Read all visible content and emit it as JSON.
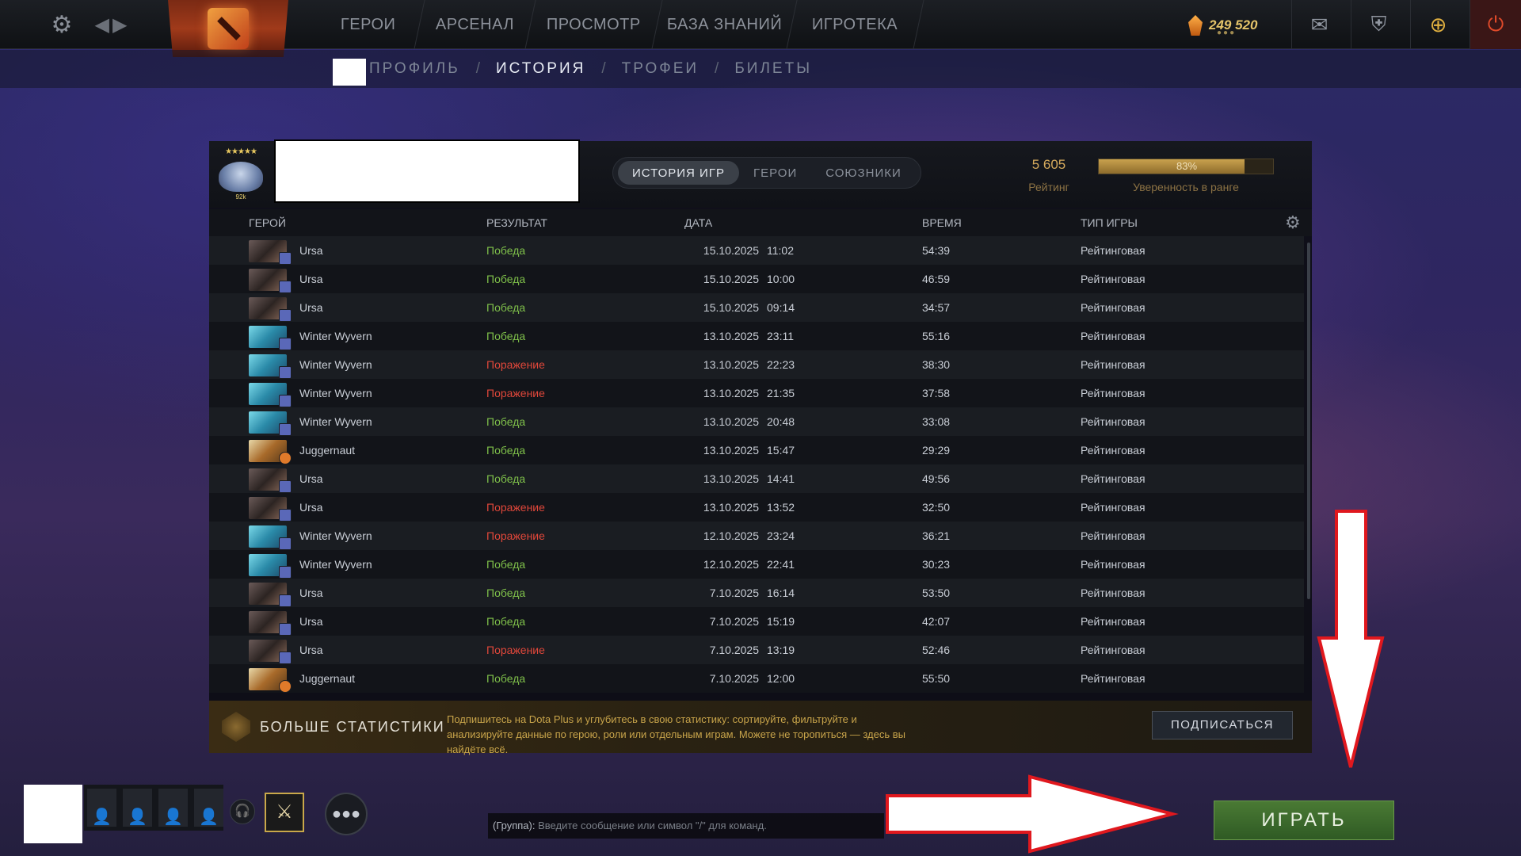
{
  "topbar": {
    "nav": [
      "ГЕРОИ",
      "АРСЕНАЛ",
      "ПРОСМОТР",
      "БАЗА ЗНАНИЙ",
      "ИГРОТЕКА"
    ],
    "currency_amount": "249 520",
    "icons": {
      "settings": "gear-icon",
      "back": "arrow-left-icon",
      "forward": "arrow-right-icon",
      "mail": "envelope-icon",
      "armory": "armory-icon",
      "dota_plus": "dota-plus-icon",
      "power": "power-icon"
    }
  },
  "subnav": {
    "items": [
      "ПРОФИЛЬ",
      "ИСТОРИЯ",
      "ТРОФЕИ",
      "БИЛЕТЫ"
    ],
    "active": "ИСТОРИЯ",
    "separator": "/"
  },
  "profile": {
    "rank_rank_number": "92k",
    "tabs": [
      "ИСТОРИЯ ИГР",
      "ГЕРОИ",
      "СОЮЗНИКИ"
    ],
    "active_tab": "ИСТОРИЯ ИГР",
    "rating_value": "5 605",
    "rating_label": "Рейтинг",
    "confidence_percent": 83,
    "confidence_text": "83%",
    "confidence_label": "Уверенность в ранге"
  },
  "table": {
    "headers": {
      "hero": "ГЕРОЙ",
      "result": "РЕЗУЛЬТАТ",
      "date": "ДАТА",
      "duration": "ВРЕМЯ",
      "mode": "ТИП ИГРЫ"
    },
    "rows": [
      {
        "hero": "Ursa",
        "result": "Победа",
        "win": true,
        "date": "15.10.2025",
        "time": "11:02",
        "duration": "54:39",
        "mode": "Рейтинговая"
      },
      {
        "hero": "Ursa",
        "result": "Победа",
        "win": true,
        "date": "15.10.2025",
        "time": "10:00",
        "duration": "46:59",
        "mode": "Рейтинговая"
      },
      {
        "hero": "Ursa",
        "result": "Победа",
        "win": true,
        "date": "15.10.2025",
        "time": "09:14",
        "duration": "34:57",
        "mode": "Рейтинговая"
      },
      {
        "hero": "Winter Wyvern",
        "result": "Победа",
        "win": true,
        "date": "13.10.2025",
        "time": "23:11",
        "duration": "55:16",
        "mode": "Рейтинговая"
      },
      {
        "hero": "Winter Wyvern",
        "result": "Поражение",
        "win": false,
        "date": "13.10.2025",
        "time": "22:23",
        "duration": "38:30",
        "mode": "Рейтинговая"
      },
      {
        "hero": "Winter Wyvern",
        "result": "Поражение",
        "win": false,
        "date": "13.10.2025",
        "time": "21:35",
        "duration": "37:58",
        "mode": "Рейтинговая"
      },
      {
        "hero": "Winter Wyvern",
        "result": "Победа",
        "win": true,
        "date": "13.10.2025",
        "time": "20:48",
        "duration": "33:08",
        "mode": "Рейтинговая"
      },
      {
        "hero": "Juggernaut",
        "result": "Победа",
        "win": true,
        "date": "13.10.2025",
        "time": "15:47",
        "duration": "29:29",
        "mode": "Рейтинговая"
      },
      {
        "hero": "Ursa",
        "result": "Победа",
        "win": true,
        "date": "13.10.2025",
        "time": "14:41",
        "duration": "49:56",
        "mode": "Рейтинговая"
      },
      {
        "hero": "Ursa",
        "result": "Поражение",
        "win": false,
        "date": "13.10.2025",
        "time": "13:52",
        "duration": "32:50",
        "mode": "Рейтинговая"
      },
      {
        "hero": "Winter Wyvern",
        "result": "Поражение",
        "win": false,
        "date": "12.10.2025",
        "time": "23:24",
        "duration": "36:21",
        "mode": "Рейтинговая"
      },
      {
        "hero": "Winter Wyvern",
        "result": "Победа",
        "win": true,
        "date": "12.10.2025",
        "time": "22:41",
        "duration": "30:23",
        "mode": "Рейтинговая"
      },
      {
        "hero": "Ursa",
        "result": "Победа",
        "win": true,
        "date": "7.10.2025",
        "time": "16:14",
        "duration": "53:50",
        "mode": "Рейтинговая"
      },
      {
        "hero": "Ursa",
        "result": "Победа",
        "win": true,
        "date": "7.10.2025",
        "time": "15:19",
        "duration": "42:07",
        "mode": "Рейтинговая"
      },
      {
        "hero": "Ursa",
        "result": "Поражение",
        "win": false,
        "date": "7.10.2025",
        "time": "13:19",
        "duration": "52:46",
        "mode": "Рейтинговая"
      },
      {
        "hero": "Juggernaut",
        "result": "Победа",
        "win": true,
        "date": "7.10.2025",
        "time": "12:00",
        "duration": "55:50",
        "mode": "Рейтинговая"
      }
    ]
  },
  "dota_plus": {
    "title": "БОЛЬШЕ СТАТИСТИКИ",
    "description": "Подпишитесь на Dota Plus и углубитесь в свою статистику: сортируйте, фильтруйте и анализируйте данные по герою, роли или отдельным играм. Можете не торопиться — здесь вы найдёте всё.",
    "subscribe_label": "ПОДПИСАТЬСЯ"
  },
  "chat": {
    "prefix": "(Группа):",
    "placeholder": "Введите сообщение или символ \"/\" для команд."
  },
  "play_label": "ИГРАТЬ",
  "colors": {
    "win": "#7fc04a",
    "loss": "#e0473a",
    "gold": "#d4a95c",
    "play_green": "#3f6c2e",
    "annotation_red": "#e0181e"
  }
}
